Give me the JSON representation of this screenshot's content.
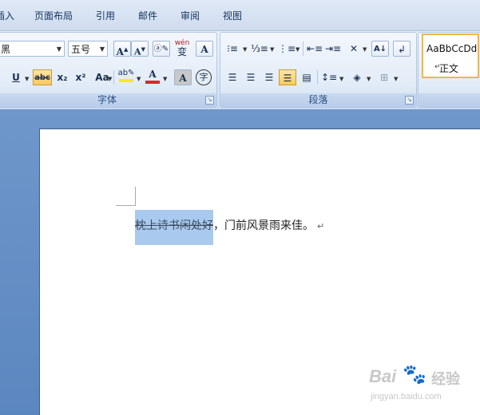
{
  "tabs": [
    "插入",
    "页面布局",
    "引用",
    "邮件",
    "审阅",
    "视图"
  ],
  "font_group": {
    "font_name": "黑",
    "font_size": "五号",
    "label": "字体",
    "icons": [
      "grow-font-icon",
      "shrink-font-icon",
      "clear-format-icon",
      "phonetic-guide-icon",
      "character-border-icon",
      "underline-icon",
      "strikethrough-icon",
      "subscript-icon",
      "superscript-icon",
      "change-case-icon",
      "text-highlight-icon",
      "font-color-icon",
      "character-shading-icon",
      "enclose-characters-icon"
    ],
    "grow_label": "A",
    "shrink_label": "A",
    "phonetic_label": "wén",
    "phonetic_char": "变",
    "border_label": "A",
    "underline_label": "U",
    "strike_label": "abc",
    "sub_label": "x₂",
    "sup_label": "x²",
    "case_label": "Aa",
    "color_label": "A",
    "shade_label": "A",
    "enclose_label": "字"
  },
  "paragraph_group": {
    "label": "段落",
    "icons": [
      "bullets-icon",
      "numbering-icon",
      "multilevel-list-icon",
      "decrease-indent-icon",
      "increase-indent-icon",
      "chinese-layout-icon",
      "sort-icon",
      "show-marks-icon",
      "align-left-icon",
      "center-icon",
      "align-right-icon",
      "justify-icon",
      "distributed-icon",
      "line-spacing-icon",
      "shading-icon",
      "borders-icon"
    ]
  },
  "styles": {
    "sample": "AaBbCcDd",
    "name": "正文",
    "mark": "↵"
  },
  "document": {
    "selected_text": "枕上诗书闲处好",
    "rest_text": "，门前风景雨来佳。",
    "para_mark": "↵"
  },
  "watermark": {
    "logo": "Bai",
    "paw": "🐾",
    "jingyan": "经验",
    "url": "jingyan.baidu.com"
  },
  "colors": {
    "selection": "#a9c9ee",
    "workspace": "#5b86bf",
    "active_button": "#ffc95c",
    "font_color_bar": "#d62b2b",
    "highlight_bar": "#f5e92c"
  }
}
